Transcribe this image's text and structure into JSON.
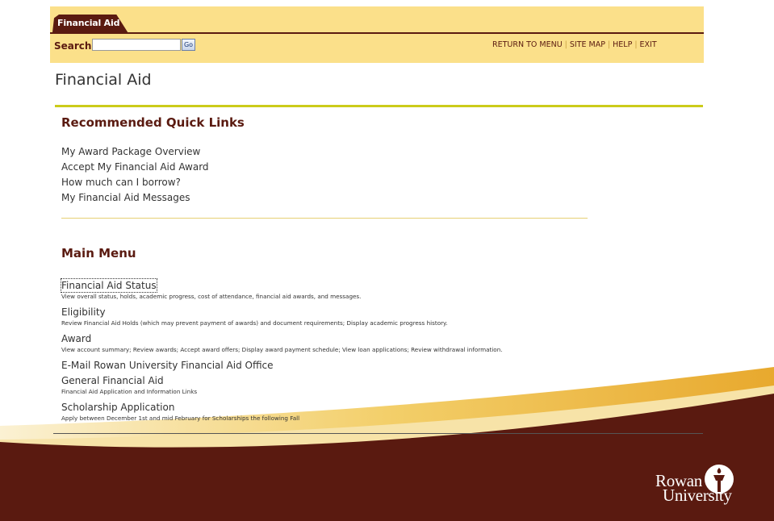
{
  "header": {
    "tab_label": "Financial Aid",
    "search_label": "Search",
    "search_value": "",
    "go_label": "Go",
    "nav": [
      "RETURN TO MENU",
      "SITE MAP",
      "HELP",
      "EXIT"
    ]
  },
  "page_title": "Financial Aid",
  "quick_links": {
    "heading": "Recommended Quick Links",
    "items": [
      "My Award Package Overview",
      "Accept My Financial Aid Award",
      "How much can I borrow?",
      "My Financial Aid Messages"
    ]
  },
  "main_menu": {
    "heading": "Main Menu",
    "items": [
      {
        "label": "Financial Aid Status",
        "desc": "View overall status, holds, academic progress, cost of attendance, financial aid awards, and messages."
      },
      {
        "label": "Eligibility",
        "desc": "Review Financial Aid Holds (which may prevent payment of awards) and document requirements; Display academic progress history."
      },
      {
        "label": "Award",
        "desc": "View account summary; Review awards; Accept award offers; Display award payment schedule; View loan applications; Review withdrawal information."
      },
      {
        "label": "E-Mail Rowan University Financial Aid Office",
        "desc": ""
      },
      {
        "label": "General Financial Aid",
        "desc": "Financial Aid Application and Information Links"
      },
      {
        "label": "Scholarship Application",
        "desc": "Apply between December 1st and mid February for Scholarships the following Fall"
      }
    ]
  },
  "logo": {
    "line1": "Rowan",
    "line2": "University",
    "icon": "torch-icon"
  },
  "colors": {
    "header_bg": "#fbe08a",
    "maroon": "#5a1a10",
    "accent_rule": "#cbcb1a",
    "gold_band": "#e9b23a"
  }
}
